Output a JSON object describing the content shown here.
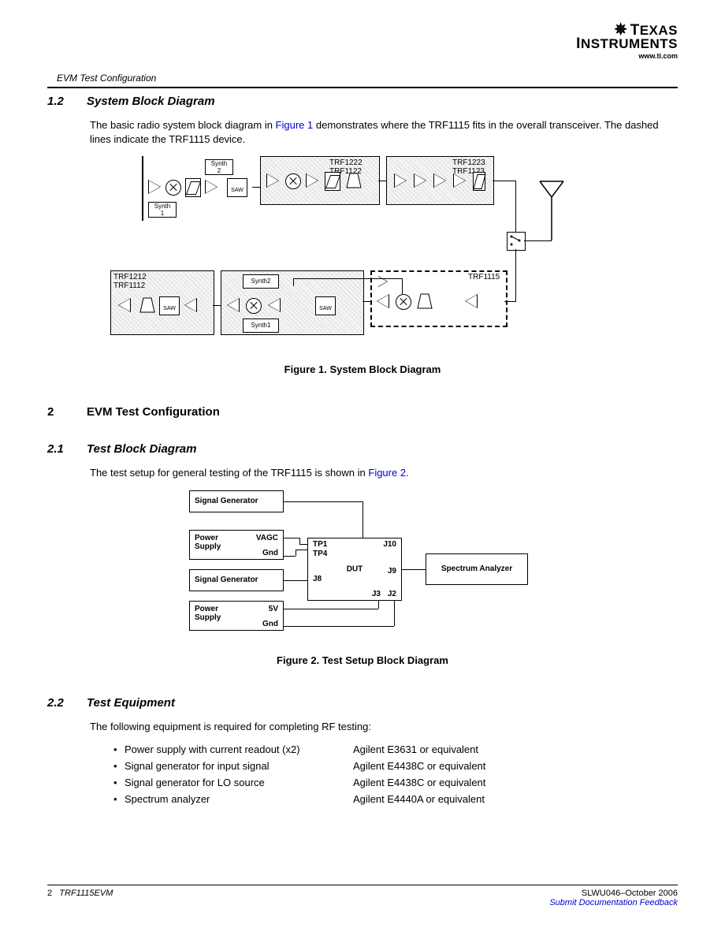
{
  "logo": {
    "company": "TEXAS INSTRUMENTS",
    "url": "www.ti.com"
  },
  "running_head": "EVM Test Configuration",
  "s12": {
    "num": "1.2",
    "title": "System Block Diagram",
    "para_a": "The basic radio system block diagram in ",
    "link": "Figure 1",
    "para_b": " demonstrates where the TRF1115 fits in the overall transceiver. The dashed lines indicate the TRF1115 device."
  },
  "fig1": {
    "caption": "Figure 1. System Block Diagram",
    "labels": {
      "synth2": "Synth\n2",
      "synth1": "Synth\n1",
      "saw": "SAW",
      "trf1222_1122": "TRF1222\nTRF1122",
      "trf1223_1123": "TRF1223\nTRF1123",
      "trf1212_1112": "TRF1212\nTRF1112",
      "synth2b": "Synth2",
      "synth1b": "Synth1",
      "trf1115": "TRF1115"
    }
  },
  "s2": {
    "num": "2",
    "title": "EVM Test Configuration"
  },
  "s21": {
    "num": "2.1",
    "title": "Test Block Diagram",
    "para_a": "The test setup for general testing of the TRF1115 is shown in ",
    "link": "Figure 2",
    "para_b": "."
  },
  "fig2": {
    "caption": "Figure 2. Test Setup Block Diagram",
    "boxes": {
      "siggen1": "Signal Generator",
      "ps1_a": "Power",
      "ps1_b": "Supply",
      "ps1_vagc": "VAGC",
      "ps1_gnd": "Gnd",
      "siggen2": "Signal Generator",
      "ps2_a": "Power",
      "ps2_b": "Supply",
      "ps2_5v": "5V",
      "ps2_gnd": "Gnd",
      "dut": "DUT",
      "tp1": "TP1",
      "tp4": "TP4",
      "j10": "J10",
      "j8": "J8",
      "j9": "J9",
      "j3": "J3",
      "j2": "J2",
      "spec": "Spectrum Analyzer"
    }
  },
  "s22": {
    "num": "2.2",
    "title": "Test Equipment",
    "intro": "The following equipment is required for completing RF testing:",
    "rows": [
      {
        "item": "Power supply with current readout (x2)",
        "equip": "Agilent E3631 or equivalent"
      },
      {
        "item": "Signal generator for input signal",
        "equip": "Agilent E4438C or equivalent"
      },
      {
        "item": "Signal generator for LO source",
        "equip": "Agilent E4438C or equivalent"
      },
      {
        "item": "Spectrum analyzer",
        "equip": "Agilent E4440A or equivalent"
      }
    ]
  },
  "footer": {
    "page": "2",
    "doc_title": "TRF1115EVM",
    "docnum": "SLWU046–October 2006",
    "feedback": "Submit Documentation Feedback"
  }
}
